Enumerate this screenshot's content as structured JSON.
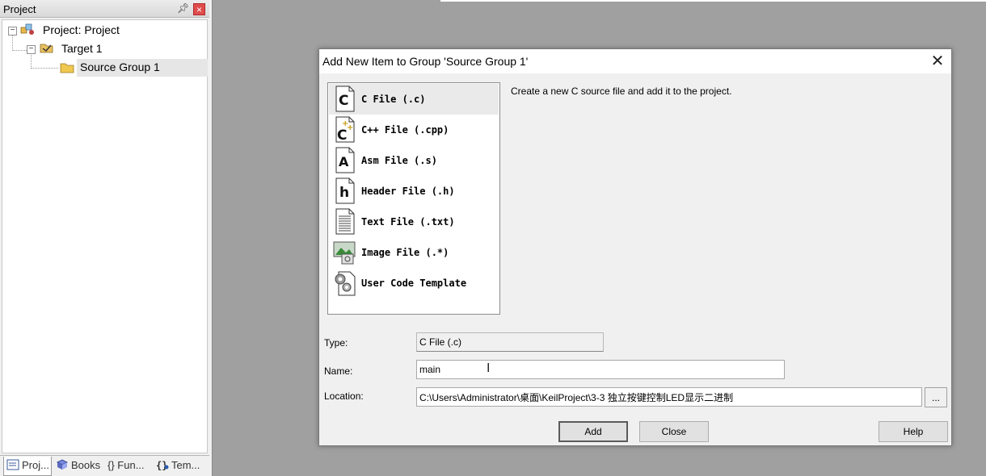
{
  "project_panel": {
    "title": "Project",
    "tree": {
      "root": "Project: Project",
      "target": "Target 1",
      "group": "Source Group 1"
    },
    "tabs": [
      {
        "label": "Proj...",
        "icon": "project-icon"
      },
      {
        "label": "Books",
        "icon": "books-icon"
      },
      {
        "label": "{} Fun...",
        "icon": "functions-icon"
      },
      {
        "label": "Tem...",
        "icon": "templates-icon"
      }
    ]
  },
  "dialog": {
    "title": "Add New Item to Group 'Source Group 1'",
    "items": [
      {
        "label": "C File (.c)",
        "icon": "c-file-icon"
      },
      {
        "label": "C++ File (.cpp)",
        "icon": "cpp-file-icon"
      },
      {
        "label": "Asm File (.s)",
        "icon": "asm-file-icon"
      },
      {
        "label": "Header File (.h)",
        "icon": "header-file-icon"
      },
      {
        "label": "Text File (.txt)",
        "icon": "text-file-icon"
      },
      {
        "label": "Image File (.*)",
        "icon": "image-file-icon"
      },
      {
        "label": "User Code Template",
        "icon": "user-template-icon"
      }
    ],
    "selected_item": "C File (.c)",
    "description": "Create a new C source file and add it to the project.",
    "type_label": "Type:",
    "type_value": "C File (.c)",
    "name_label": "Name:",
    "name_value": "main",
    "location_label": "Location:",
    "location_value": "C:\\Users\\Administrator\\桌面\\KeilProject\\3-3 独立按键控制LED显示二进制",
    "browse_label": "...",
    "buttons": {
      "add": "Add",
      "close": "Close",
      "help": "Help"
    }
  },
  "colors": {
    "background": "#a0a0a0",
    "selection": "#eaeaea",
    "close_red": "#e04c4c"
  }
}
